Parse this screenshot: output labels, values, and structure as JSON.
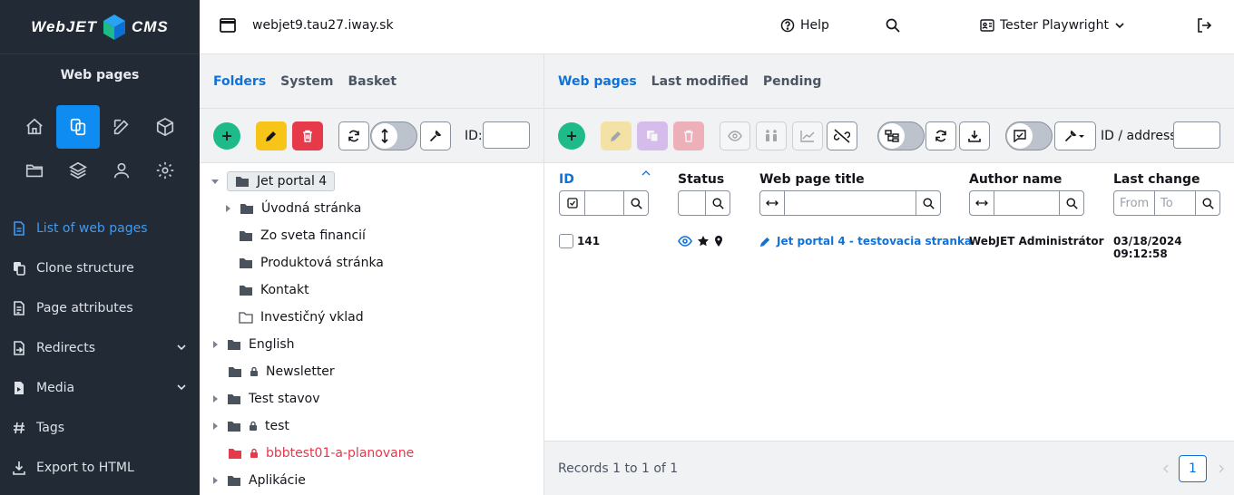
{
  "logo": {
    "left": "WebJET",
    "right": "CMS"
  },
  "sidebar": {
    "title": "Web pages",
    "menu": [
      {
        "label": "List of web pages",
        "icon": "document-icon"
      },
      {
        "label": "Clone structure",
        "icon": "clone-icon"
      },
      {
        "label": "Page attributes",
        "icon": "file-list-icon"
      },
      {
        "label": "Redirects",
        "icon": "redirect-icon"
      },
      {
        "label": "Media",
        "icon": "media-icon"
      },
      {
        "label": "Tags",
        "icon": "hashtag-icon"
      },
      {
        "label": "Export to HTML",
        "icon": "download-icon"
      }
    ]
  },
  "header": {
    "domain": "webjet9.tau27.iway.sk",
    "help": "Help",
    "user": "Tester Playwright"
  },
  "left_tabs": [
    "Folders",
    "System",
    "Basket"
  ],
  "left_toolbar": {
    "id_label": "ID:"
  },
  "tree": [
    {
      "label": "Jet portal 4"
    },
    {
      "label": "Úvodná stránka"
    },
    {
      "label": "Zo sveta financií"
    },
    {
      "label": "Produktová stránka"
    },
    {
      "label": "Kontakt"
    },
    {
      "label": "Investičný vklad"
    },
    {
      "label": "English"
    },
    {
      "label": "Newsletter"
    },
    {
      "label": "Test stavov"
    },
    {
      "label": "test"
    },
    {
      "label": "bbbtest01-a-planovane"
    },
    {
      "label": "Aplikácie"
    }
  ],
  "right_tabs": [
    "Web pages",
    "Last modified",
    "Pending"
  ],
  "right_toolbar": {
    "id_label": "ID / address:"
  },
  "table": {
    "headers": [
      "ID",
      "Status",
      "Web page title",
      "Author name",
      "Last change"
    ],
    "date_from_placeholder": "From",
    "date_to_placeholder": "To",
    "rows": [
      {
        "id": "141",
        "title": "Jet portal 4 - testovacia stranka",
        "author": "WebJET Administrátor",
        "changed": "03/18/2024 09:12:58"
      }
    ]
  },
  "footer": {
    "records": "Records 1 to 1 of 1",
    "page": "1"
  },
  "colors": {
    "accent": "#0f72d9",
    "sidebar": "#222a35",
    "green": "#1fba8a",
    "danger": "#e6394a"
  }
}
